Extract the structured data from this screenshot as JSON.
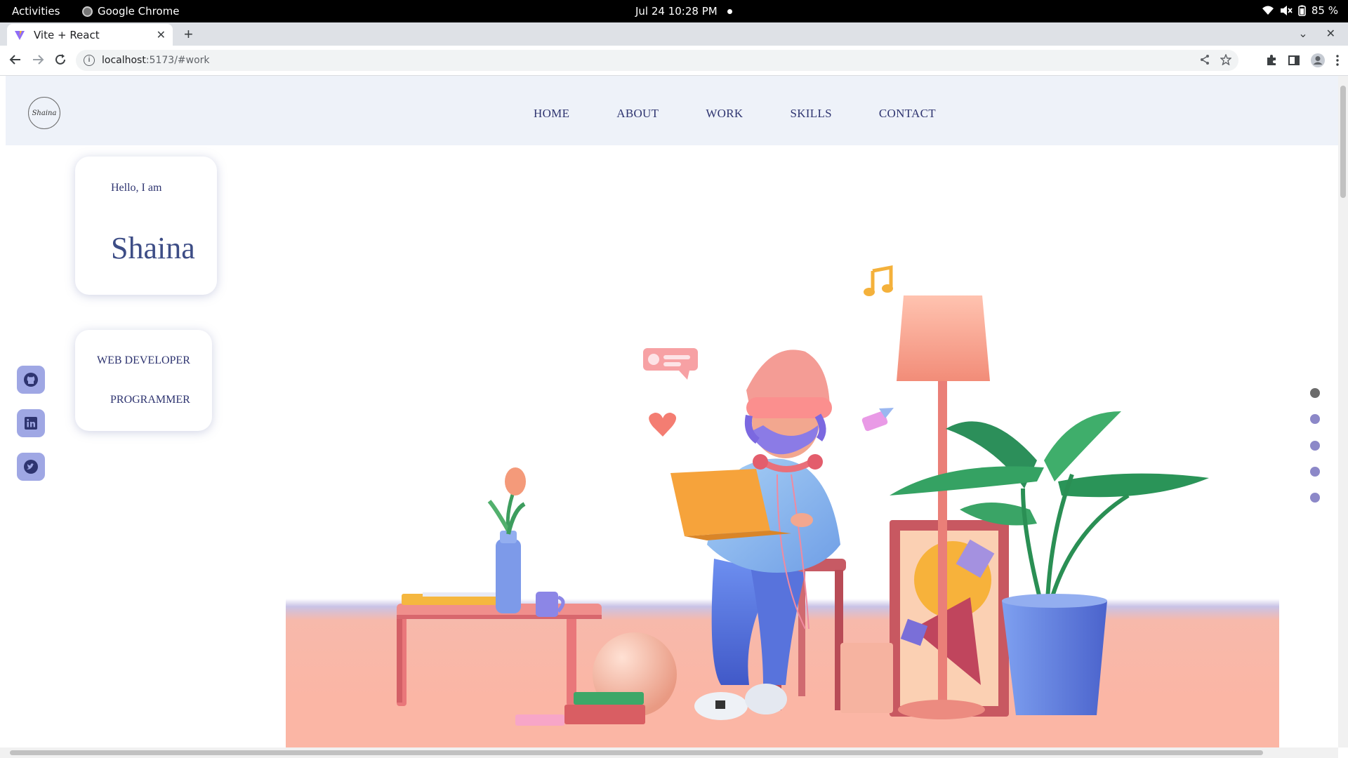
{
  "system_bar": {
    "activities": "Activities",
    "app_name": "Google Chrome",
    "clock": "Jul 24  10:28 PM",
    "battery": "85 %"
  },
  "browser": {
    "tab_title": "Vite + React",
    "url_host": "localhost",
    "url_rest": ":5173/#work"
  },
  "site": {
    "logo_text": "Shaina",
    "nav": [
      "HOME",
      "ABOUT",
      "WORK",
      "SKILLS",
      "CONTACT"
    ],
    "hello": "Hello, I am",
    "name": "Shaina",
    "roles": [
      "WEB DEVELOPER",
      "PROGRAMMER"
    ],
    "social_icons": [
      "github-icon",
      "linkedin-icon",
      "twitter-icon"
    ],
    "section_dots": 5,
    "active_dot": 0
  },
  "colors": {
    "header_bg": "#eef2f9",
    "nav_text": "#2e3470",
    "social_bg": "#9fa7e4",
    "dot": "#8c88c8",
    "floor": "#fbb6a5"
  }
}
